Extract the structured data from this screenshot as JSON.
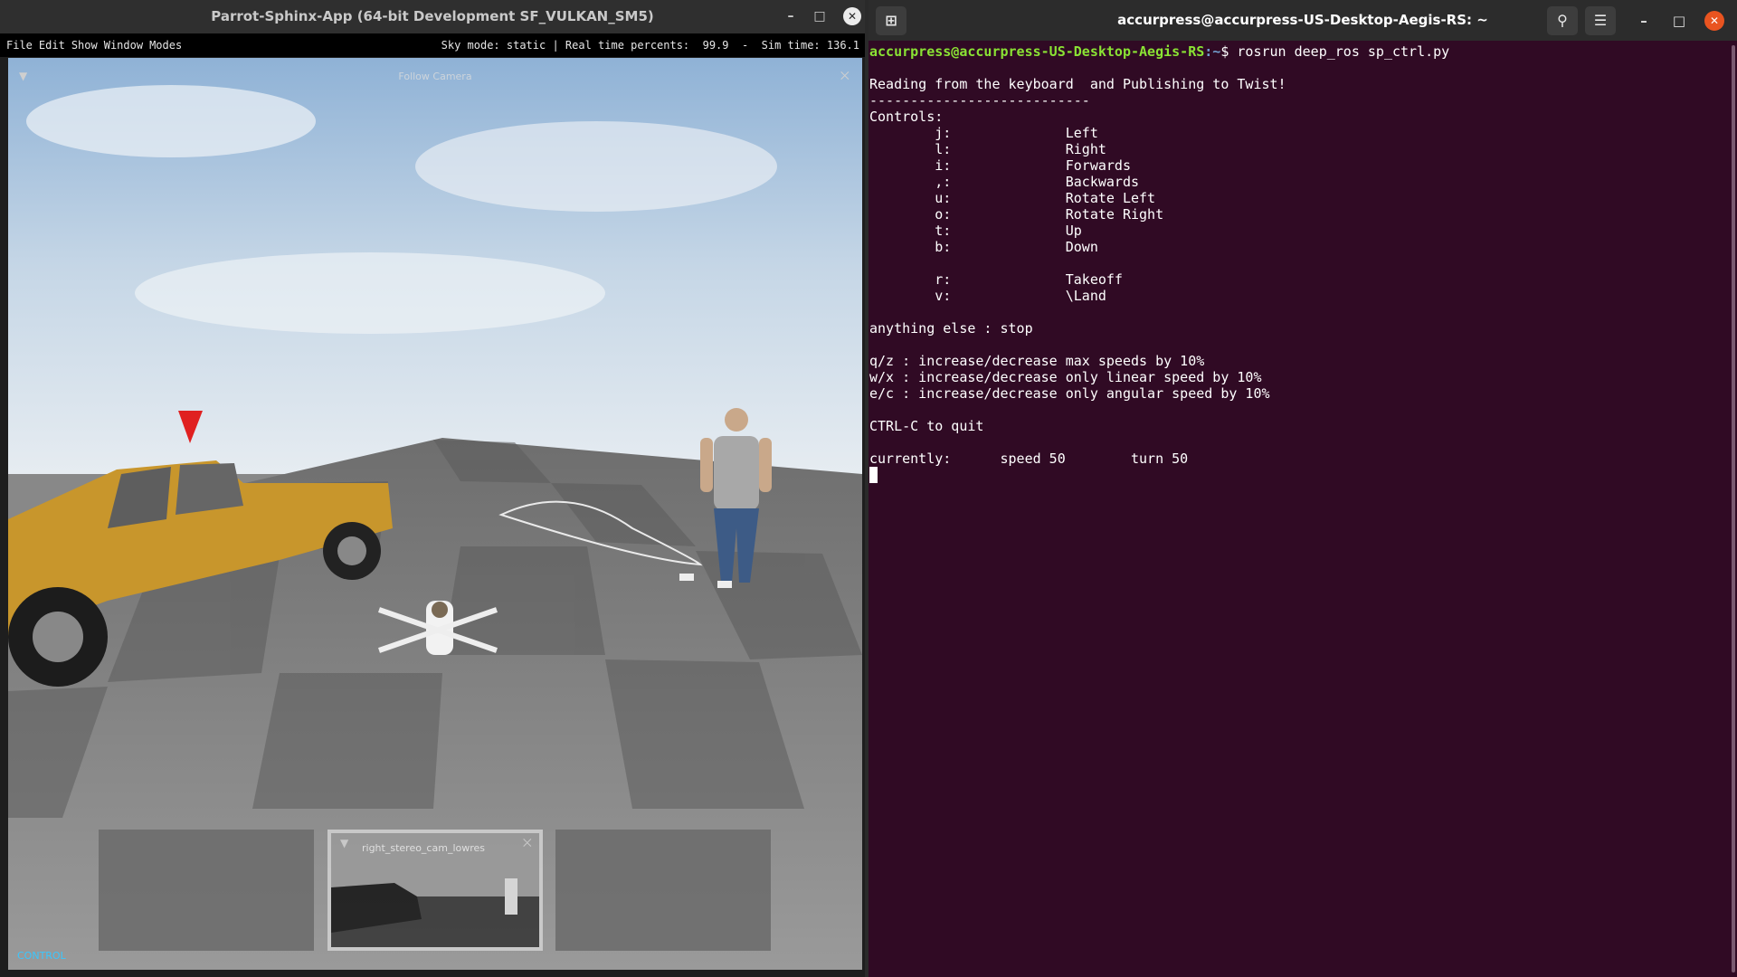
{
  "sphinx": {
    "title": "Parrot-Sphinx-App (64-bit Development SF_VULKAN_SM5)",
    "menus": [
      "File",
      "Edit",
      "Show",
      "Window",
      "Modes"
    ],
    "status": "Sky mode: static | Real time percents:  99.9  -  Sim time: 136.1",
    "follow_camera_label": "Follow Camera",
    "thumb_label": "right_stereo_cam_lowres",
    "control_label": "CONTROL",
    "window_icons": [
      "minimize-icon",
      "maximize-icon",
      "close-icon"
    ]
  },
  "terminal": {
    "title": "accurpress@accurpress-US-Desktop-Aegis-RS: ~",
    "prompt_user": "accurpress@accurpress-US-Desktop-Aegis-RS",
    "prompt_path": ":~",
    "prompt_symbol": "$",
    "command": " rosrun deep_ros sp_ctrl.py",
    "lines": [
      "",
      "Reading from the keyboard  and Publishing to Twist!",
      "---------------------------",
      "Controls:",
      "        j:              Left",
      "        l:              Right",
      "        i:              Forwards",
      "        ,:              Backwards",
      "        u:              Rotate Left",
      "        o:              Rotate Right",
      "        t:              Up",
      "        b:              Down",
      "",
      "        r:              Takeoff",
      "        v:              \\Land",
      "",
      "anything else : stop",
      "",
      "q/z : increase/decrease max speeds by 10%",
      "w/x : increase/decrease only linear speed by 10%",
      "e/c : increase/decrease only angular speed by 10%",
      "",
      "CTRL-C to quit",
      "",
      "currently:      speed 50        turn 50"
    ],
    "icons": [
      "new-tab-icon",
      "search-icon",
      "menu-icon",
      "minimize-icon",
      "maximize-icon",
      "close-icon"
    ],
    "accent_color": "#e95420",
    "background_color": "#300a24"
  }
}
